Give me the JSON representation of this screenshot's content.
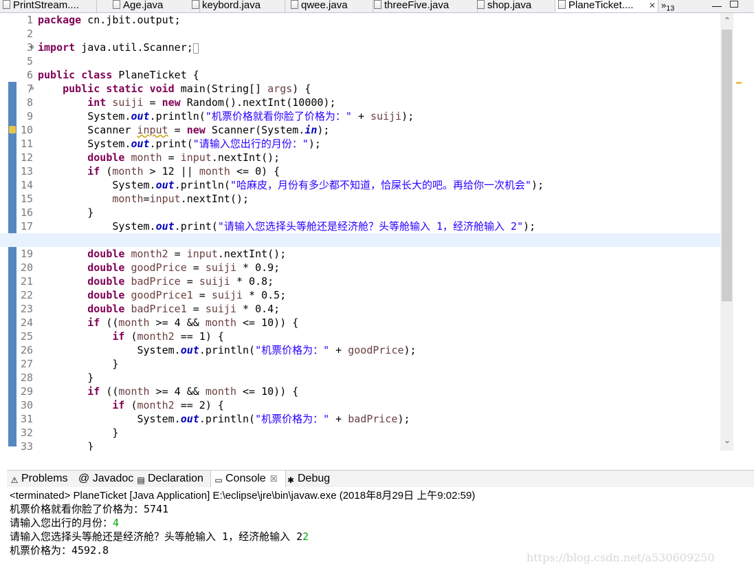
{
  "editor_tabs": [
    {
      "label": "PrintStream....",
      "active": false
    },
    {
      "label": "Age.java",
      "active": false
    },
    {
      "label": "keybord.java",
      "active": false
    },
    {
      "label": "qwee.java",
      "active": false
    },
    {
      "label": "threeFive.java",
      "active": false
    },
    {
      "label": "shop.java",
      "active": false
    },
    {
      "label": "PlaneTicket....",
      "active": true
    }
  ],
  "tab_close_glyph": "✕",
  "tab_overflow": {
    "label": "»",
    "count": "13"
  },
  "code_lines": [
    {
      "n": "1",
      "html": "<span class='kw'>package</span> cn.jbit.output;"
    },
    {
      "n": "2",
      "html": ""
    },
    {
      "n": "3",
      "html": "<span class='kw'>import</span> java.util.Scanner;<span style='border:1px solid #999;font-size:11px;'>&nbsp;</span>"
    },
    {
      "n": "5",
      "html": ""
    },
    {
      "n": "6",
      "html": "<span class='kw'>public</span> <span class='kw'>class</span> PlaneTicket {"
    },
    {
      "n": "7",
      "html": "    <span class='kw'>public</span> <span class='kw'>static</span> <span class='kw'>void</span> main(String[] <span class='var'>args</span>) {"
    },
    {
      "n": "8",
      "html": "        <span class='kw'>int</span> <span class='var'>suiji</span> = <span class='kw'>new</span> Random().nextInt(10000);"
    },
    {
      "n": "9",
      "html": "        System.<span class='fld'>out</span>.println(<span class='str'>\"机票价格就看你脸了价格为：\"</span> + <span class='var'>suiji</span>);"
    },
    {
      "n": "10",
      "html": "        Scanner <span class='var warn'>input</span> = <span class='kw'>new</span> Scanner(System.<span class='fld'>in</span>);"
    },
    {
      "n": "11",
      "html": "        System.<span class='fld'>out</span>.print(<span class='str'>\"请输入您出行的月份：\"</span>);"
    },
    {
      "n": "12",
      "html": "        <span class='kw'>double</span> <span class='var'>month</span> = <span class='var'>input</span>.nextInt();"
    },
    {
      "n": "13",
      "html": "        <span class='kw'>if</span> (<span class='var'>month</span> &gt; 12 || <span class='var'>month</span> &lt;= 0) {"
    },
    {
      "n": "14",
      "html": "            System.<span class='fld'>out</span>.println(<span class='str'>\"哈麻皮，月份有多少都不知道，恰屎长大的吧。再给你一次机会\"</span>);"
    },
    {
      "n": "15",
      "html": "            <span class='var'>month</span>=<span class='var'>input</span>.nextInt();"
    },
    {
      "n": "16",
      "html": "        }"
    },
    {
      "n": "17",
      "html": "            System.<span class='fld'>out</span>.print(<span class='str'>\"请输入您选择头等舱还是经济舱？头等舱输入 1，经济舱输入 2\"</span>);"
    },
    {
      "n": "18",
      "html": "",
      "current": true
    },
    {
      "n": "19",
      "html": "        <span class='kw'>double</span> <span class='var'>month2</span> = <span class='var'>input</span>.nextInt();"
    },
    {
      "n": "20",
      "html": "        <span class='kw'>double</span> <span class='var'>goodPrice</span> = <span class='var'>suiji</span> * 0.9;"
    },
    {
      "n": "21",
      "html": "        <span class='kw'>double</span> <span class='var'>badPrice</span> = <span class='var'>suiji</span> * 0.8;"
    },
    {
      "n": "22",
      "html": "        <span class='kw'>double</span> <span class='var'>goodPrice1</span> = <span class='var'>suiji</span> * 0.5;"
    },
    {
      "n": "23",
      "html": "        <span class='kw'>double</span> <span class='var'>badPrice1</span> = <span class='var'>suiji</span> * 0.4;"
    },
    {
      "n": "24",
      "html": "        <span class='kw'>if</span> ((<span class='var'>month</span> &gt;= 4 &amp;&amp; <span class='var'>month</span> &lt;= 10)) {"
    },
    {
      "n": "25",
      "html": "            <span class='kw'>if</span> (<span class='var'>month2</span> == 1) {"
    },
    {
      "n": "26",
      "html": "                System.<span class='fld'>out</span>.println(<span class='str'>\"机票价格为：\"</span> + <span class='var'>goodPrice</span>);"
    },
    {
      "n": "27",
      "html": "            }"
    },
    {
      "n": "28",
      "html": "        }"
    },
    {
      "n": "29",
      "html": "        <span class='kw'>if</span> ((<span class='var'>month</span> &gt;= 4 &amp;&amp; <span class='var'>month</span> &lt;= 10)) {"
    },
    {
      "n": "30",
      "html": "            <span class='kw'>if</span> (<span class='var'>month2</span> == 2) {"
    },
    {
      "n": "31",
      "html": "                System.<span class='fld'>out</span>.println(<span class='str'>\"机票价格为：\"</span> + <span class='var'>badPrice</span>);"
    },
    {
      "n": "32",
      "html": "            }"
    },
    {
      "n": "33",
      "html": "        }"
    }
  ],
  "view_tabs": [
    {
      "label": "Problems",
      "icon": "problems-icon",
      "glyph": "⚠"
    },
    {
      "label": "@ Javadoc",
      "icon": "javadoc-icon",
      "glyph": ""
    },
    {
      "label": "Declaration",
      "icon": "declaration-icon",
      "glyph": "▤"
    },
    {
      "label": "Console",
      "icon": "console-icon",
      "glyph": "▭",
      "active": true
    },
    {
      "label": "Debug",
      "icon": "debug-icon",
      "glyph": "✱"
    }
  ],
  "view_tab_close_glyph": "☒",
  "console": {
    "status": "<terminated> PlaneTicket [Java Application] E:\\eclipse\\jre\\bin\\javaw.exe (2018年8月29日 上午9:02:59)",
    "lines": [
      {
        "text": "机票价格就看你脸了价格为：5741",
        "input": ""
      },
      {
        "text": "请输入您出行的月份：",
        "input": "4"
      },
      {
        "text": "请输入您选择头等舱还是经济舱？头等舱输入 1，经济舱输入 2",
        "input": "2"
      },
      {
        "text": "机票价格为：4592.8",
        "input": ""
      }
    ]
  },
  "watermark": "https://blog.csdn.net/a530609250"
}
